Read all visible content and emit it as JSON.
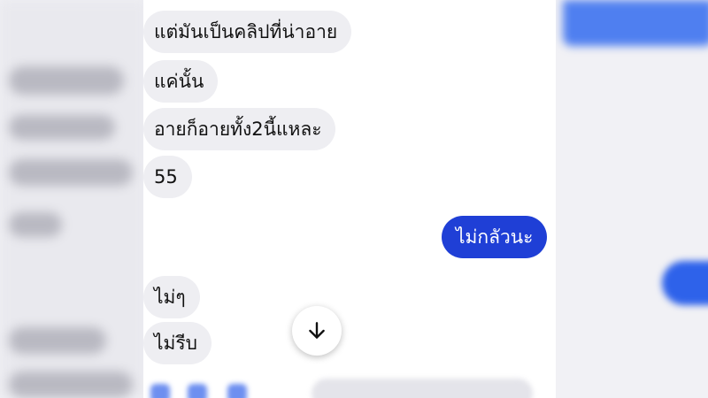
{
  "conversation": {
    "messages": [
      {
        "direction": "incoming",
        "text": "แต่มันเป็นคลิปที่น่าอาย"
      },
      {
        "direction": "incoming",
        "text": "แค่นั้น"
      },
      {
        "direction": "incoming",
        "text": "อายก็อายทั้ง2นี้แหละ"
      },
      {
        "direction": "incoming",
        "text": "55"
      },
      {
        "direction": "outgoing",
        "text": "ไม่กลัวนะ"
      },
      {
        "direction": "incoming",
        "text": "ไม่ๆ"
      },
      {
        "direction": "incoming",
        "text": "ไม่รีบ"
      }
    ]
  },
  "controls": {
    "scroll_to_bottom_icon": "arrow-down-icon"
  },
  "colors": {
    "outgoing_bubble": "#1f3fd6",
    "incoming_bubble": "#eeeef2",
    "chat_background": "#ffffff"
  }
}
